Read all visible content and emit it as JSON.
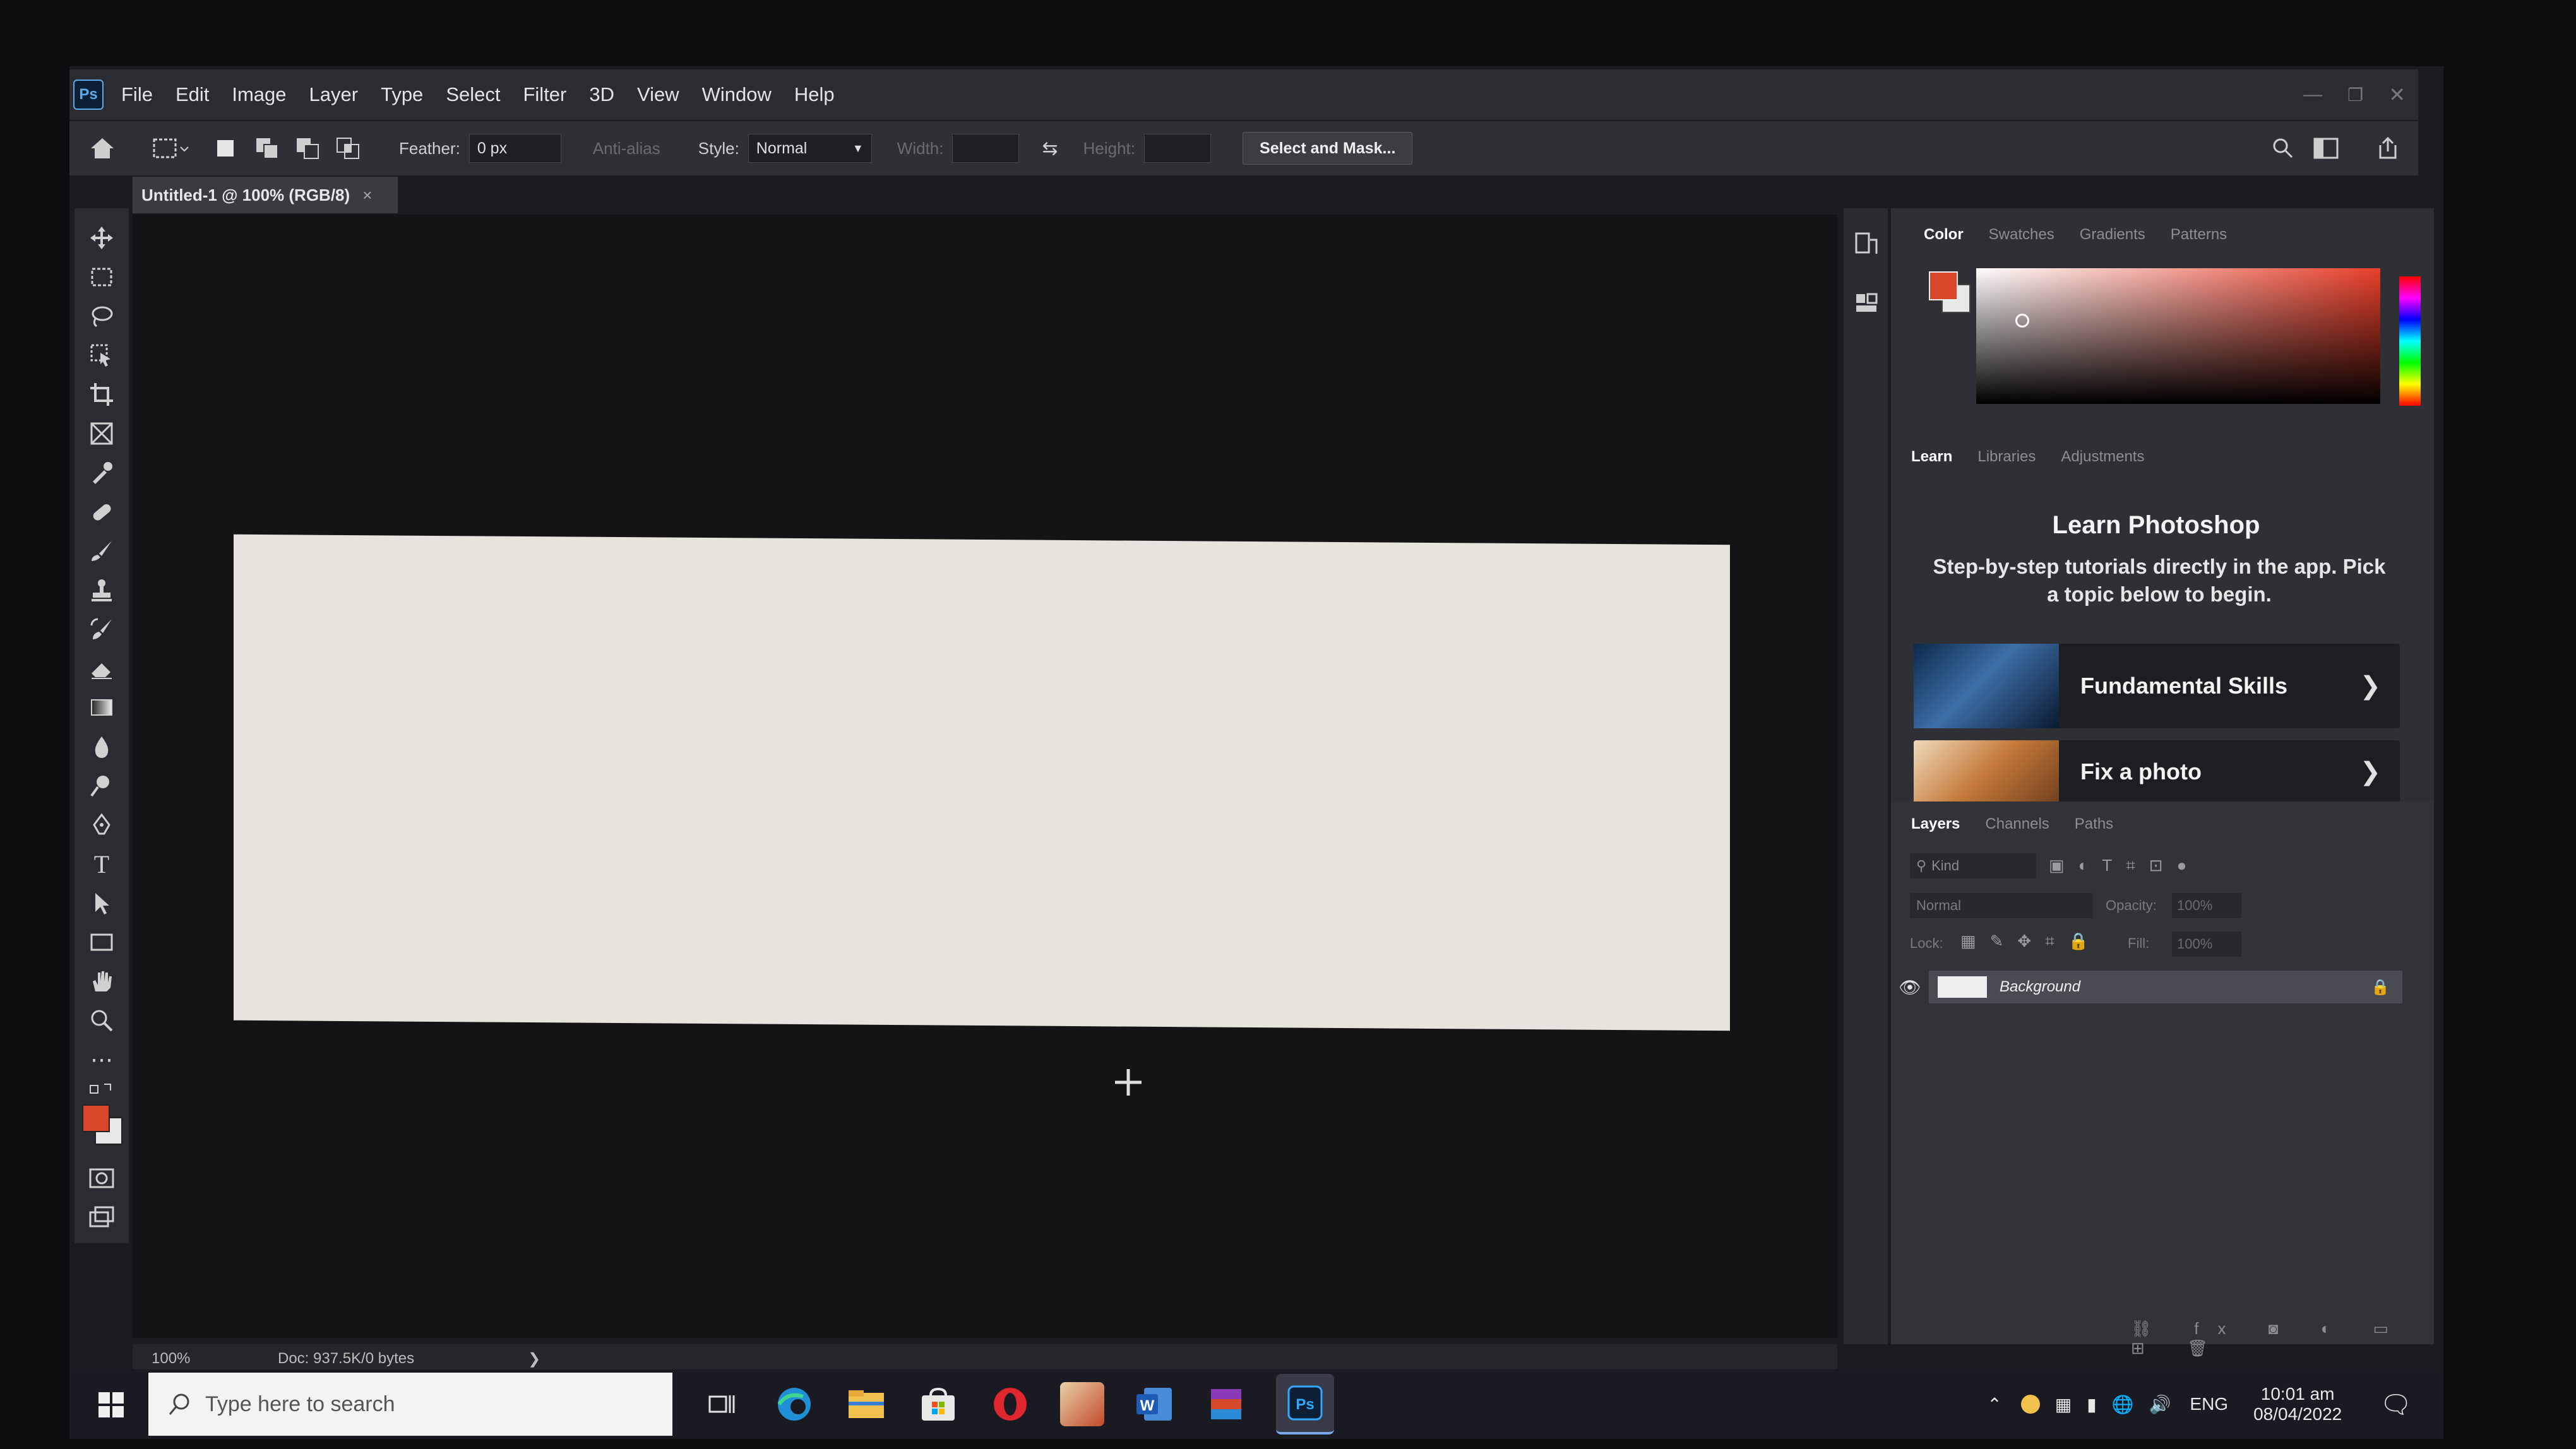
{
  "app": {
    "logo": "Ps"
  },
  "menu": [
    "File",
    "Edit",
    "Image",
    "Layer",
    "Type",
    "Select",
    "Filter",
    "3D",
    "View",
    "Window",
    "Help"
  ],
  "options": {
    "feather_label": "Feather:",
    "feather_value": "0 px",
    "antialias_label": "Anti-alias",
    "style_label": "Style:",
    "style_value": "Normal",
    "width_label": "Width:",
    "height_label": "Height:",
    "select_mask_label": "Select and Mask..."
  },
  "document": {
    "tab_title": "Untitled-1 @ 100% (RGB/8)",
    "close_glyph": "×"
  },
  "status": {
    "zoom": "100%",
    "doc_info": "Doc: 937.5K/0 bytes"
  },
  "color_panel": {
    "tabs": [
      "Color",
      "Swatches",
      "Gradients",
      "Patterns"
    ],
    "active_tab": "Color",
    "foreground": "#d9472b",
    "background": "#e8e8e8"
  },
  "learn_panel": {
    "tabs": [
      "Learn",
      "Libraries",
      "Adjustments"
    ],
    "title": "Learn Photoshop",
    "description": "Step-by-step tutorials directly in the app. Pick a topic below to begin.",
    "cards": [
      {
        "label": "Fundamental Skills"
      },
      {
        "label": "Fix a photo"
      }
    ]
  },
  "layers_panel": {
    "tabs": [
      "Layers",
      "Channels",
      "Paths"
    ],
    "kind_label": "Kind",
    "blend_mode": "Normal",
    "opacity_label": "Opacity:",
    "opacity_value": "100%",
    "lock_label": "Lock:",
    "fill_label": "Fill:",
    "fill_value": "100%",
    "layers": [
      {
        "name": "Background",
        "visible": true,
        "locked": true
      }
    ]
  },
  "taskbar": {
    "search_placeholder": "Type here to search",
    "language": "ENG",
    "time": "10:01 am",
    "date": "08/04/2022"
  }
}
